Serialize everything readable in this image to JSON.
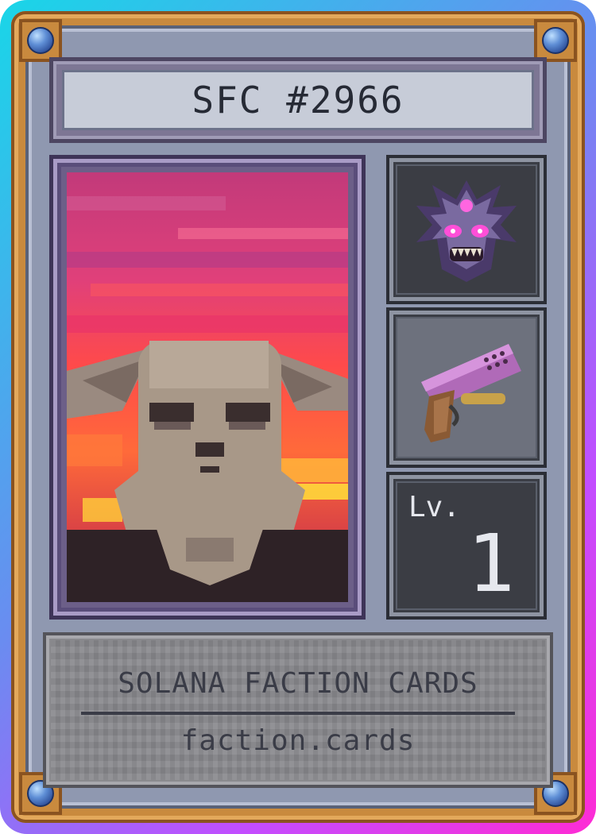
{
  "card": {
    "title": "SFC #2966",
    "footer_title": "SOLANA FACTION CARDS",
    "footer_url": "faction.cards",
    "level_label": "Lv.",
    "level_value": "1"
  },
  "icons": {
    "portrait": "rabbit-creature-portrait",
    "faction_emblem": "demon-mask-icon",
    "weapon": "pistol-icon"
  },
  "colors": {
    "border_gradient": [
      "#19d6e8",
      "#c24dff",
      "#ff2bd4"
    ],
    "gold": "#c98a3e",
    "steel": "#8f98b0",
    "text_dark": "#262a35",
    "text_light": "#e6e8ee"
  }
}
